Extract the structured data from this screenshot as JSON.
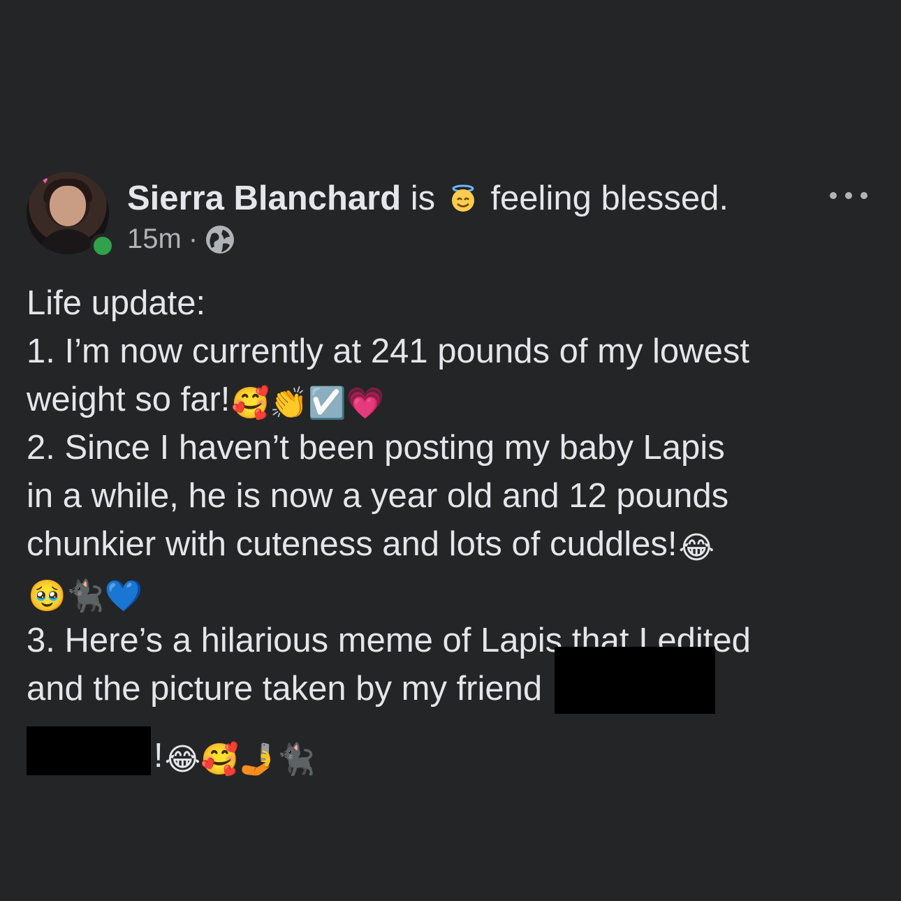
{
  "post": {
    "author": "Sierra Blanchard",
    "is_text": "is",
    "feeling_text": "feeling blessed.",
    "feeling_icon": "smiling-face-with-halo",
    "timestamp": "15m",
    "separator": "·",
    "audience_icon": "globe-icon",
    "more_icon": "more-options-icon",
    "body_lines": {
      "l1": "Life update:",
      "l2": "1. I’m now currently at 241 pounds of my lowest",
      "l3": "weight so far!",
      "l3_emojis": "🥰👏☑️💗",
      "l4": " 2. Since I haven’t been posting my baby Lapis",
      "l5": "in a while, he is now a year old and 12 pounds",
      "l6": "chunkier with cuteness and lots of cuddles!",
      "l6_emojis": "😂",
      "l7_emojis": "🥹🐈‍⬛💙",
      "l8": "3. Here’s a hilarious meme of Lapis that I edited",
      "l9": "and the picture taken by my friend",
      "l10": "!",
      "l10_emojis": "😂🥰🤳🐈‍⬛"
    },
    "colors": {
      "background": "#242526",
      "text_primary": "#e4e6eb",
      "text_secondary": "#b0b3b8",
      "online": "#31a24c",
      "redaction": "#000000"
    }
  }
}
